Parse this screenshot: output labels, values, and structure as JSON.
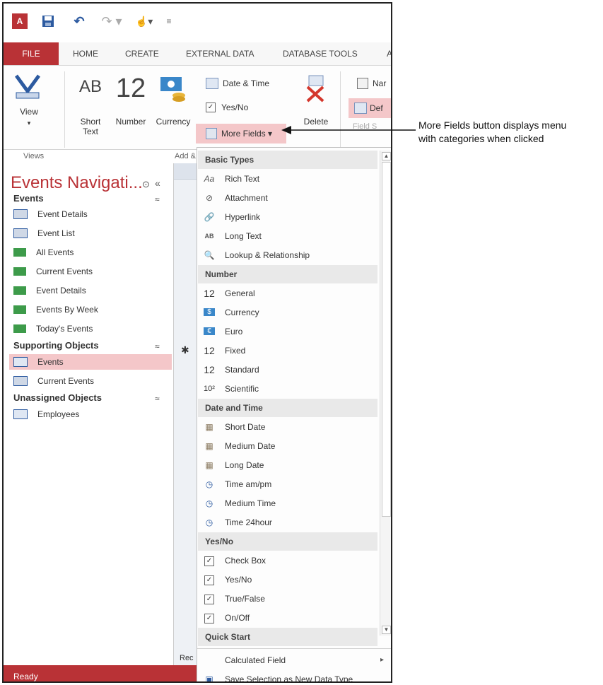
{
  "qat": {
    "app_icon": "A",
    "icons": [
      "save-icon",
      "undo-icon",
      "redo-icon",
      "touch-mode-icon",
      "customize-icon"
    ]
  },
  "tabs": [
    "FILE",
    "HOME",
    "CREATE",
    "EXTERNAL DATA",
    "DATABASE TOOLS",
    "A"
  ],
  "ribbon": {
    "view": {
      "label": "View",
      "arrow": "▾"
    },
    "short_text": {
      "icon": "AB",
      "label": "Short Text"
    },
    "number": {
      "icon": "12",
      "label": "Number"
    },
    "currency": {
      "label": "Currency"
    },
    "date_time": "Date & Time",
    "yes_no": "Yes/No",
    "more_fields": "More Fields ▾",
    "delete": "Delete",
    "name_partial": "Nar",
    "default_partial": "Def",
    "field_partial": "Field S",
    "group_views": "Views",
    "group_add": "Add &"
  },
  "nav": {
    "title": "Events Navigati...",
    "sections": [
      {
        "header": "Events",
        "items": [
          "Event Details",
          "Event List",
          "All Events",
          "Current Events",
          "Event Details",
          "Events By Week",
          "Today's Events"
        ]
      },
      {
        "header": "Supporting Objects",
        "items": [
          "Events",
          "Current Events"
        ]
      },
      {
        "header": "Unassigned Objects",
        "items": [
          "Employees"
        ]
      }
    ]
  },
  "sheet": {
    "record_label": "Rec",
    "new_row": "✱"
  },
  "status": "Ready",
  "menu": {
    "categories": [
      {
        "name": "Basic Types",
        "items": [
          {
            "icon": "Aa",
            "label": "Rich Text"
          },
          {
            "icon": "⊘",
            "label": "Attachment"
          },
          {
            "icon": "🔗",
            "label": "Hyperlink"
          },
          {
            "icon": "AB",
            "label": "Long Text"
          },
          {
            "icon": "🔍",
            "label": "Lookup & Relationship"
          }
        ]
      },
      {
        "name": "Number",
        "items": [
          {
            "icon": "12",
            "label": "General"
          },
          {
            "icon": "$",
            "label": "Currency"
          },
          {
            "icon": "€",
            "label": "Euro"
          },
          {
            "icon": "12",
            "label": "Fixed"
          },
          {
            "icon": "12",
            "label": "Standard"
          },
          {
            "icon": "10²",
            "label": "Scientific"
          }
        ]
      },
      {
        "name": "Date and Time",
        "items": [
          {
            "icon": "▦",
            "label": "Short Date"
          },
          {
            "icon": "▦",
            "label": "Medium Date"
          },
          {
            "icon": "▦",
            "label": "Long Date"
          },
          {
            "icon": "◷",
            "label": "Time am/pm"
          },
          {
            "icon": "◷",
            "label": "Medium Time"
          },
          {
            "icon": "◷",
            "label": "Time 24hour"
          }
        ]
      },
      {
        "name": "Yes/No",
        "items": [
          {
            "icon": "✓",
            "label": "Check Box"
          },
          {
            "icon": "✓",
            "label": "Yes/No"
          },
          {
            "icon": "✓",
            "label": "True/False"
          },
          {
            "icon": "✓",
            "label": "On/Off"
          }
        ]
      },
      {
        "name": "Quick Start",
        "items": []
      }
    ],
    "footer": [
      {
        "label": "Calculated Field",
        "arrow": "▸"
      },
      {
        "label": "Save Selection as New Data Type"
      }
    ]
  },
  "annotation": {
    "line1": "More Fields button displays menu",
    "line2": "with categories when clicked"
  },
  "colors": {
    "accent": "#b93236",
    "highlight": "#f4c7c9"
  }
}
